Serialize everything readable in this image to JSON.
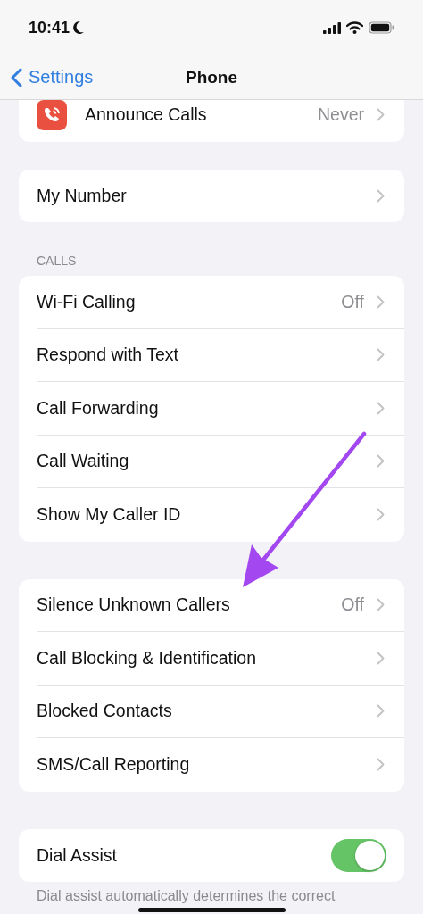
{
  "status_bar": {
    "time": "10:41"
  },
  "nav": {
    "back": "Settings",
    "title": "Phone"
  },
  "groups": [
    {
      "rows": [
        {
          "kind": "icon_link",
          "label": "Announce Calls",
          "value": "Never"
        }
      ]
    },
    {
      "rows": [
        {
          "kind": "link",
          "label": "My Number"
        }
      ]
    },
    {
      "header": "CALLS",
      "rows": [
        {
          "kind": "link",
          "label": "Wi-Fi Calling",
          "value": "Off"
        },
        {
          "kind": "link",
          "label": "Respond with Text"
        },
        {
          "kind": "link",
          "label": "Call Forwarding"
        },
        {
          "kind": "link",
          "label": "Call Waiting"
        },
        {
          "kind": "link",
          "label": "Show My Caller ID"
        }
      ]
    },
    {
      "rows": [
        {
          "kind": "link",
          "label": "Silence Unknown Callers",
          "value": "Off"
        },
        {
          "kind": "link",
          "label": "Call Blocking & Identification"
        },
        {
          "kind": "link",
          "label": "Blocked Contacts"
        },
        {
          "kind": "link",
          "label": "SMS/Call Reporting"
        }
      ]
    },
    {
      "rows": [
        {
          "kind": "toggle",
          "label": "Dial Assist",
          "on": true
        }
      ],
      "footer": "Dial assist automatically determines the correct"
    }
  ]
}
